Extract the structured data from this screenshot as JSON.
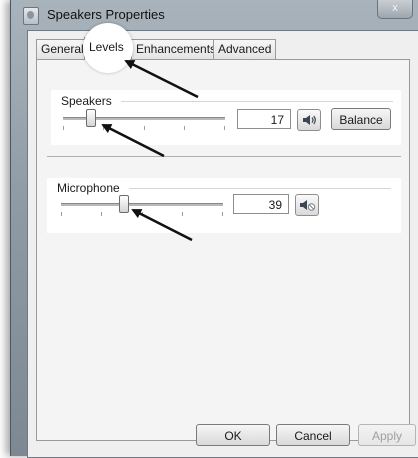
{
  "window": {
    "title": "Speakers Properties",
    "close_glyph": "x"
  },
  "tabs": [
    {
      "label": "General",
      "active": false
    },
    {
      "label": "Levels",
      "active": true
    },
    {
      "label": "Enhancements",
      "active": false
    },
    {
      "label": "Advanced",
      "active": false
    }
  ],
  "speakers": {
    "label": "Speakers",
    "value": "17",
    "level_percent": 17,
    "icon": "speaker-icon",
    "balance_label": "Balance"
  },
  "microphone": {
    "label": "Microphone",
    "value": "39",
    "level_percent": 39,
    "icon": "microphone-muted-icon"
  },
  "footer": {
    "ok_label": "OK",
    "cancel_label": "Cancel",
    "apply_label": "Apply"
  },
  "annotation": {
    "arrow_color": "#111111"
  }
}
